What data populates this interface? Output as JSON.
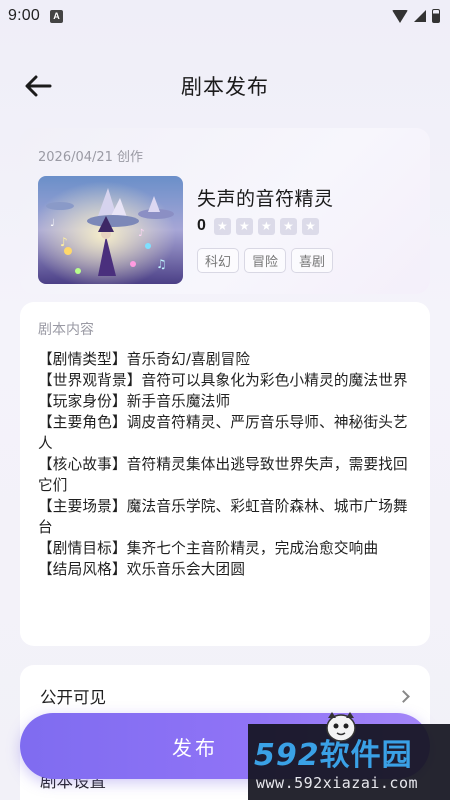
{
  "status_bar": {
    "time": "9:00",
    "notification_letter": "A"
  },
  "header": {
    "title": "剧本发布"
  },
  "script_card": {
    "created": "2026/04/21 创作",
    "name": "失声的音符精灵",
    "rating": "0",
    "stars": 5,
    "tags": [
      "科幻",
      "冒险",
      "喜剧"
    ]
  },
  "content_card": {
    "label": "剧本内容",
    "lines": [
      "【剧情类型】音乐奇幻/喜剧冒险",
      "【世界观背景】音符可以具象化为彩色小精灵的魔法世界",
      "【玩家身份】新手音乐魔法师",
      "【主要角色】调皮音符精灵、严厉音乐导师、神秘街头艺人",
      "【核心故事】音符精灵集体出逃导致世界失声，需要找回它们",
      "【主要场景】魔法音乐学院、彩虹音阶森林、城市广场舞台",
      "【剧情目标】集齐七个主音阶精灵，完成治愈交响曲",
      "【结局风格】欢乐音乐会大团圆"
    ]
  },
  "settings_card": {
    "visibility_label": "公开可见",
    "settings_label": "剧本设置"
  },
  "publish_button": {
    "label": "发布"
  },
  "watermark": {
    "brand_num": "592",
    "brand_cn": "软件园",
    "url": "www.592xiazai.com"
  },
  "colors": {
    "accent": "#8a70f4",
    "star_empty": "#dcdbe9"
  }
}
